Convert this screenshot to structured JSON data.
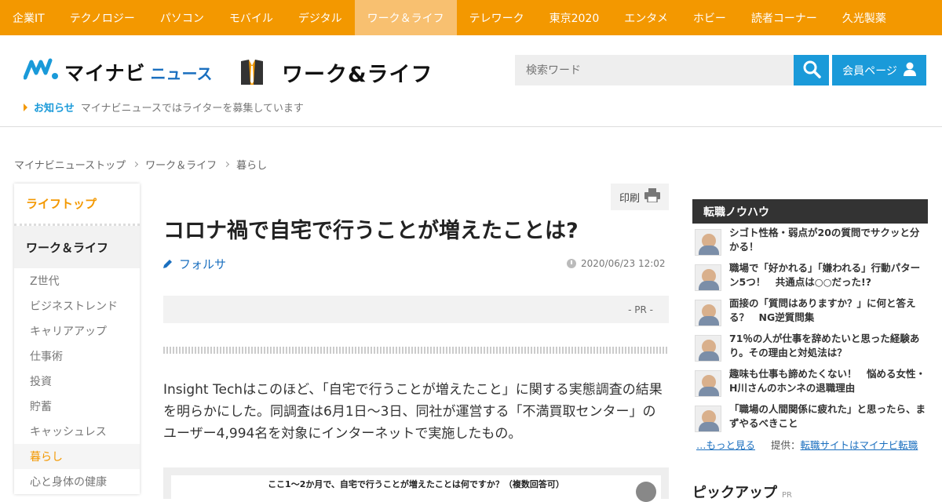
{
  "topnav": {
    "items": [
      "企業IT",
      "テクノロジー",
      "パソコン",
      "モバイル",
      "デジタル",
      "ワーク＆ライフ",
      "テレワーク",
      "東京2020",
      "エンタメ",
      "ホビー",
      "読者コーナー",
      "久光製薬"
    ],
    "active_index": 5
  },
  "header": {
    "logo_text": "マイナビ",
    "logo_news": "ニュース",
    "section_title": "ワーク&ライフ",
    "search_placeholder": "検索ワード",
    "member_label": "会員ページ",
    "notice_label": "お知らせ",
    "notice_text": "マイナビニュースではライターを募集しています"
  },
  "breadcrumb": [
    "マイナビニューストップ",
    "ワーク＆ライフ",
    "暮らし"
  ],
  "leftnav": {
    "top_link": "ライフトップ",
    "category": "ワーク＆ライフ",
    "items": [
      "Z世代",
      "ビジネストレンド",
      "キャリアアップ",
      "仕事術",
      "投資",
      "貯蓄",
      "キャッシュレス",
      "暮らし",
      "心と身体の健康"
    ],
    "active_index": 7
  },
  "article": {
    "print_label": "印刷",
    "title": "コロナ禍で自宅で行うことが増えたことは?",
    "author": "フォルサ",
    "date": "2020/06/23 12:02",
    "pr_label": "- PR -",
    "body": "Insight Techはこのほど、「自宅で行うことが増えたこと」に関する実態調査の結果を明らかにした。同調査は6月1日～3日、同社が運営する「不満買取センター」のユーザー4,994名を対象にインターネットで実施したもの。",
    "figure_caption": "ここ1～2か月で、自宅で行うことが増えたことは何ですか？（複数回答可）"
  },
  "rightbar": {
    "heading": "転職ノウハウ",
    "items": [
      "シゴト性格・弱点が20の質問でサクッと分かる！",
      "職場で「好かれる」「嫌われる」行動パターン5つ！　共通点は○○だった!?",
      "面接の「質問はありますか？」に何と答える？　NG逆質問集",
      "71％の人が仕事を辞めたいと思った経験あり。その理由と対処法は？",
      "趣味も仕事も諦めたくない！　悩める女性・H川さんのホンネの退職理由",
      "「職場の人間関係に疲れた」と思ったら、まずやるべきこと"
    ],
    "more_link": "…もっと見る",
    "source_label": "提供：",
    "source_link": "転職サイトはマイナビ転職",
    "pickup_title": "ピックアップ",
    "pickup_pr": "PR"
  },
  "colors": {
    "nav_orange": "#f39800",
    "nav_active": "#f8c070",
    "brand_blue": "#1a9ad9",
    "link_blue": "#1a6fbf"
  }
}
